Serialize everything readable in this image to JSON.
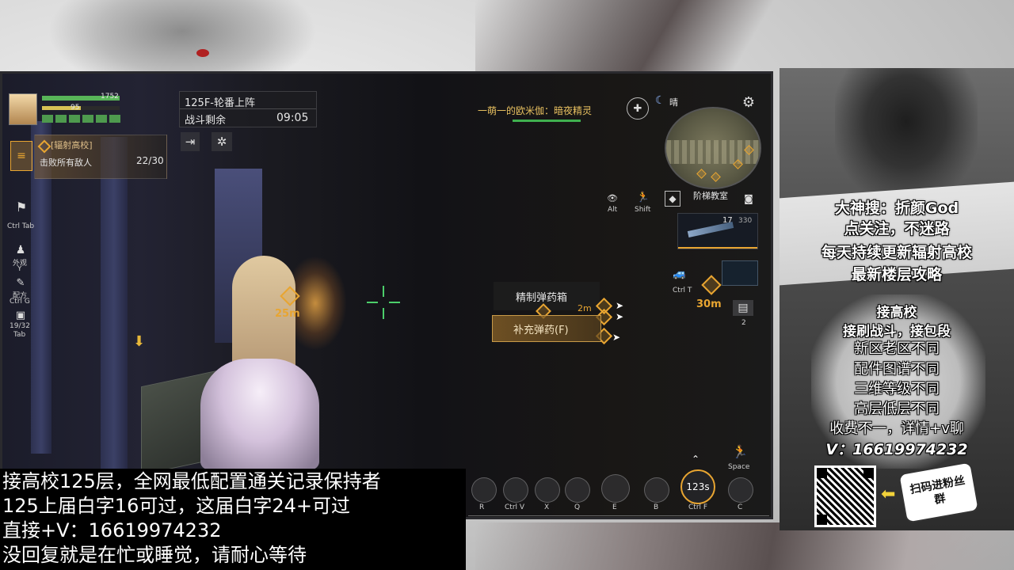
{
  "hud": {
    "hp_value": "1752",
    "armor_value": "95",
    "mission": {
      "floor_title": "125F-轮番上阵",
      "time_label": "战斗剩余",
      "time_value": "09:05"
    },
    "quest": {
      "name": "[辐射高校]",
      "objective": "击败所有敌人",
      "progress": "22/30"
    },
    "left_keys": {
      "flag_key": "Ctrl Tab",
      "outfit_label": "外观",
      "outfit_key": "Y",
      "recipe_label": "配方",
      "recipe_key": "Ctrl G",
      "bag_count": "19/32",
      "bag_key": "Tab"
    },
    "team_notice": "一萌一的欧米伽：暗夜精灵",
    "weather": "晴",
    "minimap_location": "阶梯教室",
    "stance_keys": {
      "alt": "Alt",
      "shift": "Shift"
    },
    "weapon": {
      "ammo": "17",
      "reserve": "330"
    },
    "vehicle_key": "Ctrl T",
    "marker_distance_right": "30m",
    "marker_distance_left": "25m",
    "item_count": "2",
    "interact": {
      "title": "精制弹药箱",
      "action": "补充弹药(F)",
      "dist_fragment": "2m"
    },
    "skills": [
      {
        "key": "R"
      },
      {
        "key": "Ctrl V"
      },
      {
        "key": "X"
      },
      {
        "key": "Q"
      },
      {
        "key": "E"
      },
      {
        "key": "B"
      },
      {
        "key": "Ctrl F",
        "cooldown": "123s"
      },
      {
        "key": "C"
      }
    ],
    "space_key": "Space"
  },
  "side_ad": {
    "lines": [
      "大神搜：折颜God",
      "点关注，不迷路",
      "每天持续更新辐射高校",
      "最新楼层攻略",
      "接高校",
      "接刷战斗，接包段",
      "新区老区不同",
      "配件图谱不同",
      "三维等级不同",
      "高层低层不同",
      "收费不一，详情+v聊",
      "V：16619974232"
    ],
    "qr_caption": "扫码进粉丝群"
  },
  "overlay": {
    "lines": [
      "接高校125层，全网最低配置通关记录保持者",
      "125上届白字16可过，这届白字24+可过",
      "直接+V：16619974232",
      "没回复就是在忙或睡觉，请耐心等待"
    ]
  },
  "colors": {
    "hud_gold": "#e8a531",
    "hp_green": "#6fc16f",
    "hp_bar": "#58b558",
    "overlay_bg": "#000000"
  }
}
